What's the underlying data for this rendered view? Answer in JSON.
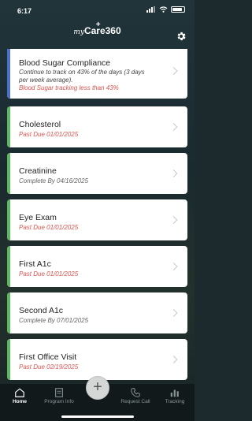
{
  "status_bar": {
    "time": "6:17"
  },
  "header": {
    "logo_prefix": "my",
    "logo_text": "Care360",
    "logo_cross": "+",
    "settings_icon": "gear-icon"
  },
  "colors": {
    "bar_blue": "#4a6fd1",
    "bar_green": "#5cb85c",
    "due_red": "#d9534f"
  },
  "cards": [
    {
      "title": "Blood Sugar Compliance",
      "line1": "Continue to track on 43% of the days (3 days",
      "line2": "per week average).",
      "line3": "Blood Sugar tracking less than 43%"
    },
    {
      "title": "Cholesterol",
      "subtitle": "Past Due 01/01/2025"
    },
    {
      "title": "Creatinine",
      "subtitle": "Complete By 04/16/2025"
    },
    {
      "title": "Eye Exam",
      "subtitle": "Past Due 01/01/2025"
    },
    {
      "title": "First A1c",
      "subtitle": "Past Due 01/01/2025"
    },
    {
      "title": "Second A1c",
      "subtitle": "Complete By 07/01/2025"
    },
    {
      "title": "First Office Visit",
      "subtitle": "Past Due 02/19/2025"
    }
  ],
  "nav": {
    "home": "Home",
    "program_info": "Program Info",
    "add": "+",
    "request_call": "Request Call",
    "tracking": "Tracking"
  }
}
